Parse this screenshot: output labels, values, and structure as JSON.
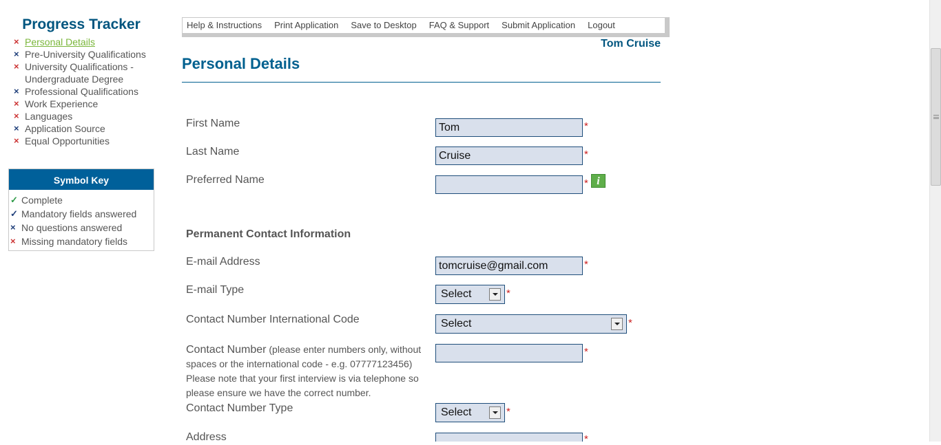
{
  "sidebar": {
    "title": "Progress Tracker",
    "items": [
      {
        "label": "Personal Details",
        "status": "red",
        "active": true
      },
      {
        "label": "Pre-University Qualifications",
        "status": "blue"
      },
      {
        "label": "University Qualifications - Undergraduate Degree",
        "status": "red"
      },
      {
        "label": "Professional Qualifications",
        "status": "blue"
      },
      {
        "label": "Work Experience",
        "status": "red"
      },
      {
        "label": "Languages",
        "status": "red"
      },
      {
        "label": "Application Source",
        "status": "blue"
      },
      {
        "label": "Equal Opportunities",
        "status": "red"
      }
    ],
    "symbol_key": {
      "title": "Symbol Key",
      "items": [
        {
          "label": "Complete",
          "symbol": "✓",
          "color": "#2e9a47"
        },
        {
          "label": "Mandatory fields answered",
          "symbol": "✓",
          "color": "#1f3f7a"
        },
        {
          "label": "No questions answered",
          "symbol": "×",
          "color": "#1f3f7a"
        },
        {
          "label": "Missing mandatory fields",
          "symbol": "×",
          "color": "#cc3333"
        }
      ]
    }
  },
  "nav": {
    "help": "Help & Instructions",
    "print": "Print Application",
    "save": "Save to Desktop",
    "faq": "FAQ & Support",
    "submit": "Submit Application",
    "logout": "Logout"
  },
  "user": {
    "name": "Tom Cruise"
  },
  "page": {
    "title": "Personal Details"
  },
  "form": {
    "first_name": {
      "label": "First Name",
      "value": "Tom"
    },
    "last_name": {
      "label": "Last Name",
      "value": "Cruise"
    },
    "preferred_name": {
      "label": "Preferred Name",
      "value": ""
    },
    "contact_section": "Permanent Contact Information",
    "email": {
      "label": "E-mail Address",
      "value": "tomcruise@gmail.com"
    },
    "email_type": {
      "label": "E-mail Type",
      "value": "Select"
    },
    "intl_code": {
      "label": "Contact Number International Code",
      "value": "Select"
    },
    "contact_number": {
      "label": "Contact Number",
      "hint": " (please enter numbers only, without spaces or the international code - e.g. 07777123456) Please note that your first interview is via telephone so please ensure we have the correct number.",
      "value": ""
    },
    "contact_type": {
      "label": "Contact Number Type",
      "value": "Select"
    },
    "address": {
      "label": "Address",
      "value": ""
    },
    "required_mark": "*",
    "info_icon": "i"
  },
  "colors": {
    "brand": "#00557f",
    "header_bg": "#00609a",
    "input_bg": "#d9e0ec",
    "link_active": "#7ab63a",
    "required": "#cc2222"
  }
}
